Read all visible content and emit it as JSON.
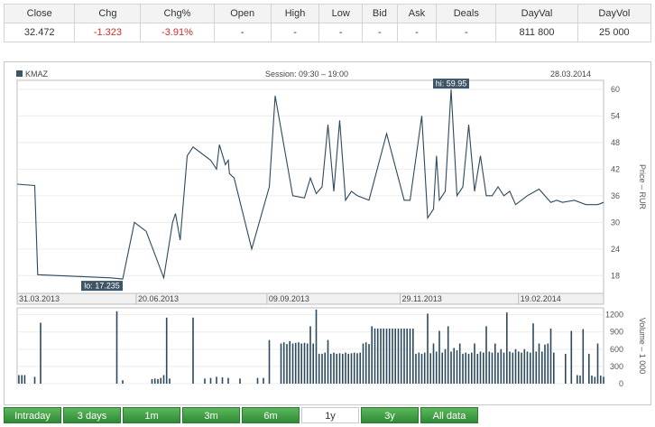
{
  "quote": {
    "headers": [
      "Close",
      "Chg",
      "Chg%",
      "Open",
      "High",
      "Low",
      "Bid",
      "Ask",
      "Deals",
      "DayVal",
      "DayVol"
    ],
    "values": [
      "32.472",
      "-1.323",
      "-3.91%",
      "-",
      "-",
      "-",
      "-",
      "-",
      "-",
      "811 800",
      "25 000"
    ]
  },
  "chart_header": {
    "ticker": "KMAZ",
    "session": "Session: 09:30 – 19:00",
    "date": "28.03.2014"
  },
  "colors": {
    "line": "#2b4a5e",
    "volume": "#2b4a5e",
    "label_bg": "#3d5566",
    "negative": "#d42a2a",
    "tab": "#3c9a41"
  },
  "chart_data": {
    "type": "line",
    "price": {
      "ylabel": "Price – RUR",
      "yticks": [
        18,
        24,
        30,
        36,
        42,
        48,
        54,
        60
      ],
      "ylim": [
        14,
        62
      ],
      "hi_label": "hi: 59.95",
      "lo_label": "lo: 17.235",
      "x": [
        0.0,
        0.03,
        0.035,
        0.16,
        0.18,
        0.2,
        0.21,
        0.22,
        0.25,
        0.265,
        0.27,
        0.278,
        0.29,
        0.3,
        0.33,
        0.34,
        0.345,
        0.355,
        0.36,
        0.362,
        0.37,
        0.4,
        0.43,
        0.44,
        0.47,
        0.49,
        0.5,
        0.51,
        0.52,
        0.53,
        0.54,
        0.55,
        0.56,
        0.57,
        0.58,
        0.6,
        0.63,
        0.66,
        0.67,
        0.69,
        0.7,
        0.71,
        0.715,
        0.72,
        0.73,
        0.74,
        0.75,
        0.76,
        0.77,
        0.78,
        0.79,
        0.8,
        0.81,
        0.82,
        0.83,
        0.84,
        0.85,
        0.87,
        0.89,
        0.91,
        0.92,
        0.93,
        0.95,
        0.97,
        0.99,
        1.0
      ],
      "y": [
        38.6,
        38.3,
        18.2,
        17.5,
        17.235,
        30,
        29,
        28,
        17.5,
        30,
        32,
        26,
        45,
        47,
        44,
        42,
        47.5,
        43,
        44,
        41,
        40,
        24,
        38,
        58.5,
        36,
        35.5,
        40,
        36.5,
        38,
        52,
        37,
        53,
        35,
        37,
        36,
        35,
        50,
        35,
        35,
        54,
        31,
        33,
        45,
        35,
        37,
        59.95,
        36,
        38,
        52,
        37,
        45,
        36,
        36,
        38,
        36,
        37,
        34,
        36,
        37.5,
        34.5,
        35,
        34.5,
        35,
        34,
        34,
        34.5
      ],
      "x_date_labels": [
        {
          "x": 0.0,
          "label": "31.03.2013"
        },
        {
          "x": 0.203,
          "label": "20.06.2013"
        },
        {
          "x": 0.426,
          "label": "09.09.2013"
        },
        {
          "x": 0.653,
          "label": "29.11.2013"
        },
        {
          "x": 0.855,
          "label": "19.02.2014"
        }
      ]
    },
    "volume": {
      "ylabel": "Volume – 1 000",
      "yticks": [
        0,
        300,
        600,
        900,
        1200
      ],
      "ylim": [
        0,
        1320
      ],
      "bars": [
        {
          "x": 0.003,
          "v": 150
        },
        {
          "x": 0.008,
          "v": 150
        },
        {
          "x": 0.013,
          "v": 150
        },
        {
          "x": 0.03,
          "v": 120
        },
        {
          "x": 0.04,
          "v": 1060
        },
        {
          "x": 0.17,
          "v": 1260
        },
        {
          "x": 0.18,
          "v": 60
        },
        {
          "x": 0.23,
          "v": 80
        },
        {
          "x": 0.235,
          "v": 90
        },
        {
          "x": 0.24,
          "v": 80
        },
        {
          "x": 0.245,
          "v": 100
        },
        {
          "x": 0.25,
          "v": 150
        },
        {
          "x": 0.255,
          "v": 1150
        },
        {
          "x": 0.26,
          "v": 90
        },
        {
          "x": 0.3,
          "v": 1150
        },
        {
          "x": 0.32,
          "v": 90
        },
        {
          "x": 0.33,
          "v": 100
        },
        {
          "x": 0.34,
          "v": 120
        },
        {
          "x": 0.35,
          "v": 110
        },
        {
          "x": 0.36,
          "v": 100
        },
        {
          "x": 0.38,
          "v": 90
        },
        {
          "x": 0.41,
          "v": 100
        },
        {
          "x": 0.42,
          "v": 100
        },
        {
          "x": 0.43,
          "v": 760
        },
        {
          "x": 0.45,
          "v": 700
        },
        {
          "x": 0.455,
          "v": 720
        },
        {
          "x": 0.46,
          "v": 690
        },
        {
          "x": 0.465,
          "v": 740
        },
        {
          "x": 0.47,
          "v": 700
        },
        {
          "x": 0.475,
          "v": 710
        },
        {
          "x": 0.48,
          "v": 720
        },
        {
          "x": 0.485,
          "v": 700
        },
        {
          "x": 0.49,
          "v": 710
        },
        {
          "x": 0.495,
          "v": 700
        },
        {
          "x": 0.5,
          "v": 1000
        },
        {
          "x": 0.505,
          "v": 700
        },
        {
          "x": 0.51,
          "v": 1290
        },
        {
          "x": 0.515,
          "v": 520
        },
        {
          "x": 0.52,
          "v": 520
        },
        {
          "x": 0.525,
          "v": 540
        },
        {
          "x": 0.53,
          "v": 760
        },
        {
          "x": 0.535,
          "v": 520
        },
        {
          "x": 0.54,
          "v": 540
        },
        {
          "x": 0.545,
          "v": 520
        },
        {
          "x": 0.55,
          "v": 530
        },
        {
          "x": 0.555,
          "v": 520
        },
        {
          "x": 0.56,
          "v": 540
        },
        {
          "x": 0.565,
          "v": 520
        },
        {
          "x": 0.57,
          "v": 530
        },
        {
          "x": 0.575,
          "v": 540
        },
        {
          "x": 0.58,
          "v": 530
        },
        {
          "x": 0.585,
          "v": 540
        },
        {
          "x": 0.59,
          "v": 700
        },
        {
          "x": 0.595,
          "v": 720
        },
        {
          "x": 0.6,
          "v": 690
        },
        {
          "x": 0.605,
          "v": 1000
        },
        {
          "x": 0.61,
          "v": 960
        },
        {
          "x": 0.615,
          "v": 960
        },
        {
          "x": 0.62,
          "v": 960
        },
        {
          "x": 0.625,
          "v": 960
        },
        {
          "x": 0.63,
          "v": 960
        },
        {
          "x": 0.635,
          "v": 960
        },
        {
          "x": 0.64,
          "v": 960
        },
        {
          "x": 0.645,
          "v": 960
        },
        {
          "x": 0.65,
          "v": 960
        },
        {
          "x": 0.655,
          "v": 960
        },
        {
          "x": 0.66,
          "v": 960
        },
        {
          "x": 0.665,
          "v": 960
        },
        {
          "x": 0.67,
          "v": 960
        },
        {
          "x": 0.675,
          "v": 960
        },
        {
          "x": 0.68,
          "v": 520
        },
        {
          "x": 0.685,
          "v": 540
        },
        {
          "x": 0.69,
          "v": 520
        },
        {
          "x": 0.695,
          "v": 540
        },
        {
          "x": 0.7,
          "v": 1220
        },
        {
          "x": 0.705,
          "v": 530
        },
        {
          "x": 0.71,
          "v": 700
        },
        {
          "x": 0.715,
          "v": 560
        },
        {
          "x": 0.72,
          "v": 920
        },
        {
          "x": 0.725,
          "v": 540
        },
        {
          "x": 0.73,
          "v": 600
        },
        {
          "x": 0.735,
          "v": 1000
        },
        {
          "x": 0.74,
          "v": 560
        },
        {
          "x": 0.745,
          "v": 620
        },
        {
          "x": 0.75,
          "v": 580
        },
        {
          "x": 0.755,
          "v": 700
        },
        {
          "x": 0.76,
          "v": 520
        },
        {
          "x": 0.765,
          "v": 540
        },
        {
          "x": 0.77,
          "v": 520
        },
        {
          "x": 0.775,
          "v": 540
        },
        {
          "x": 0.78,
          "v": 700
        },
        {
          "x": 0.785,
          "v": 520
        },
        {
          "x": 0.79,
          "v": 560
        },
        {
          "x": 0.795,
          "v": 540
        },
        {
          "x": 0.8,
          "v": 1000
        },
        {
          "x": 0.805,
          "v": 560
        },
        {
          "x": 0.81,
          "v": 540
        },
        {
          "x": 0.815,
          "v": 700
        },
        {
          "x": 0.82,
          "v": 540
        },
        {
          "x": 0.825,
          "v": 600
        },
        {
          "x": 0.83,
          "v": 540
        },
        {
          "x": 0.835,
          "v": 1240
        },
        {
          "x": 0.84,
          "v": 560
        },
        {
          "x": 0.845,
          "v": 540
        },
        {
          "x": 0.85,
          "v": 600
        },
        {
          "x": 0.855,
          "v": 560
        },
        {
          "x": 0.86,
          "v": 540
        },
        {
          "x": 0.865,
          "v": 600
        },
        {
          "x": 0.87,
          "v": 560
        },
        {
          "x": 0.875,
          "v": 540
        },
        {
          "x": 0.88,
          "v": 1050
        },
        {
          "x": 0.885,
          "v": 560
        },
        {
          "x": 0.89,
          "v": 700
        },
        {
          "x": 0.895,
          "v": 560
        },
        {
          "x": 0.9,
          "v": 680
        },
        {
          "x": 0.905,
          "v": 700
        },
        {
          "x": 0.91,
          "v": 960
        },
        {
          "x": 0.915,
          "v": 540
        },
        {
          "x": 0.935,
          "v": 520
        },
        {
          "x": 0.945,
          "v": 920
        },
        {
          "x": 0.955,
          "v": 150
        },
        {
          "x": 0.96,
          "v": 140
        },
        {
          "x": 0.965,
          "v": 950
        },
        {
          "x": 0.975,
          "v": 520
        },
        {
          "x": 0.98,
          "v": 140
        },
        {
          "x": 0.985,
          "v": 120
        },
        {
          "x": 0.99,
          "v": 700
        },
        {
          "x": 0.995,
          "v": 140
        },
        {
          "x": 1.0,
          "v": 120
        }
      ]
    }
  },
  "tabs": [
    {
      "label": "Intraday",
      "active": false
    },
    {
      "label": "3 days",
      "active": false
    },
    {
      "label": "1m",
      "active": false
    },
    {
      "label": "3m",
      "active": false
    },
    {
      "label": "6m",
      "active": false
    },
    {
      "label": "1y",
      "active": true
    },
    {
      "label": "3y",
      "active": false
    },
    {
      "label": "All data",
      "active": false
    }
  ]
}
